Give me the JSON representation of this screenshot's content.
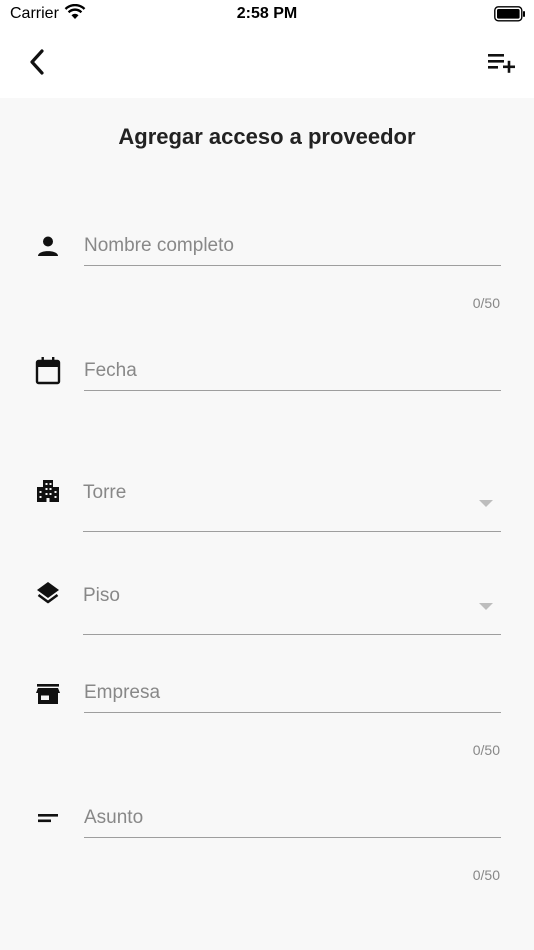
{
  "status_bar": {
    "carrier": "Carrier",
    "time": "2:58 PM"
  },
  "nav": {
    "back_icon": "chevron-left-icon",
    "action_icon": "playlist-add-icon"
  },
  "form": {
    "title": "Agregar acceso a proveedor",
    "fields": {
      "nombre": {
        "placeholder": "Nombre completo",
        "counter": "0/50",
        "icon": "person-icon"
      },
      "fecha": {
        "placeholder": "Fecha",
        "icon": "calendar-icon"
      },
      "torre": {
        "label": "Torre",
        "icon": "buildings-icon"
      },
      "piso": {
        "label": "Piso",
        "icon": "layers-icon"
      },
      "empresa": {
        "placeholder": "Empresa",
        "counter": "0/50",
        "icon": "store-icon"
      },
      "asunto": {
        "placeholder": "Asunto",
        "counter": "0/50",
        "icon": "short-text-icon"
      }
    }
  }
}
